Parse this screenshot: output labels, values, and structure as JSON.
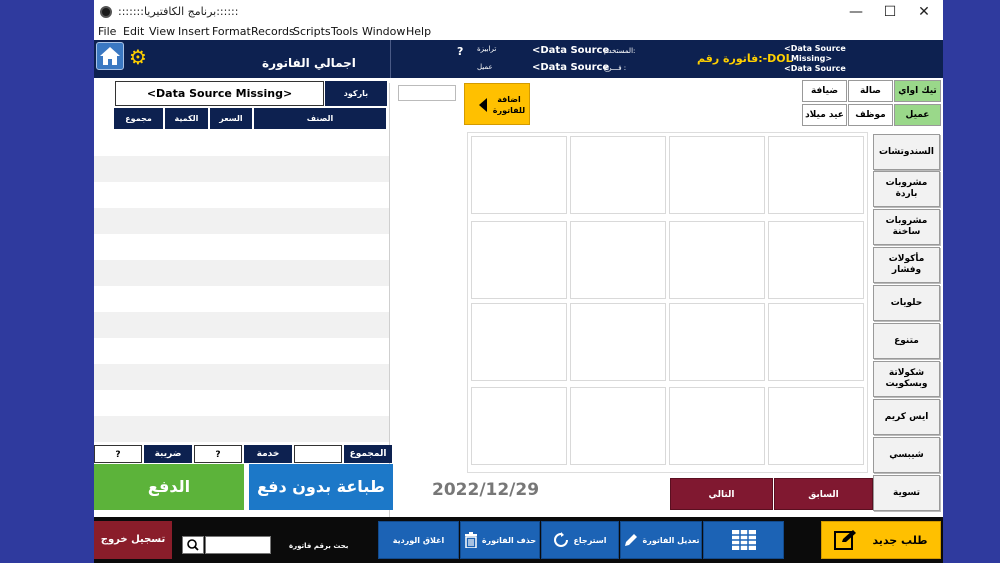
{
  "window": {
    "title": ":::::::برنامج الكافتيريا::::::",
    "controls": [
      "—",
      "☐",
      "✕"
    ]
  },
  "menu": [
    "File",
    "Edit",
    "View",
    "Insert",
    "Format",
    "Records",
    "Scripts",
    "Tools",
    "Window",
    "Help"
  ],
  "topbar": {
    "invoice_total_label": "اجمالي الفاتورة",
    "q_mark": "?",
    "table_label": "ترابيزة",
    "customer_label": "عميل",
    "user_ds": "<Data Source",
    "user_label": "المستخدم:",
    "branch_ds": "<Data Source",
    "branch_label": "فـــرع :",
    "invoice_no": "فاتورة رقم:-DOL",
    "ds_right_1": "<Data Source",
    "ds_right_2": "Missing>",
    "ds_right_3": "<Data Source"
  },
  "invoice": {
    "barcode_value": "<Data Source Missing>",
    "barcode_label": "باركود",
    "col_item": "الصنف",
    "col_price": "السعر",
    "col_qty": "الكمية",
    "col_total": "مجموع"
  },
  "summary": {
    "total_label": "المجموع",
    "service_label": "خدمة",
    "service_value": "?",
    "tax_label": "ضريبة",
    "tax_value": "?"
  },
  "buttons": {
    "pay": "الدفع",
    "print_no_pay": "طباعة بدون دفع",
    "add_to_invoice": "اضافة للفاتورة",
    "prev": "السابق",
    "next": "التالي"
  },
  "date": "2022/12/29",
  "order_types": [
    {
      "label": "تيك اواي",
      "color": "#9ad88a"
    },
    {
      "label": "صالة",
      "color": "#ffffff"
    },
    {
      "label": "ضيافة",
      "color": "#ffffff"
    },
    {
      "label": "عميل",
      "color": "#9ad88a"
    },
    {
      "label": "موظف",
      "color": "#ffffff"
    },
    {
      "label": "عيد ميلاد",
      "color": "#ffffff"
    }
  ],
  "categories": [
    "السندوتشات",
    "مشروبات باردة",
    "مشروبات ساخنة",
    "مأكولات وفشار",
    "حلويات",
    "متنوع",
    "شكولاتة وبسكويت",
    "ايس كريم",
    "شيبسي",
    "تسوية"
  ],
  "bottom": {
    "exit": "تسجيل خروج",
    "search_label": "بحث برقم فاتورة",
    "close_shift": "اغلاق الوردية",
    "delete_invoice": "حذف الفاتورة",
    "refund": "استرجاع",
    "edit_invoice": "تعديل الفاتورة",
    "new_order": "طلب جديد"
  },
  "colors": {
    "navy": "#0d2150",
    "green": "#5cb33a",
    "blue": "#1c78c8",
    "yellow": "#ffc000",
    "maroon": "#801830"
  }
}
